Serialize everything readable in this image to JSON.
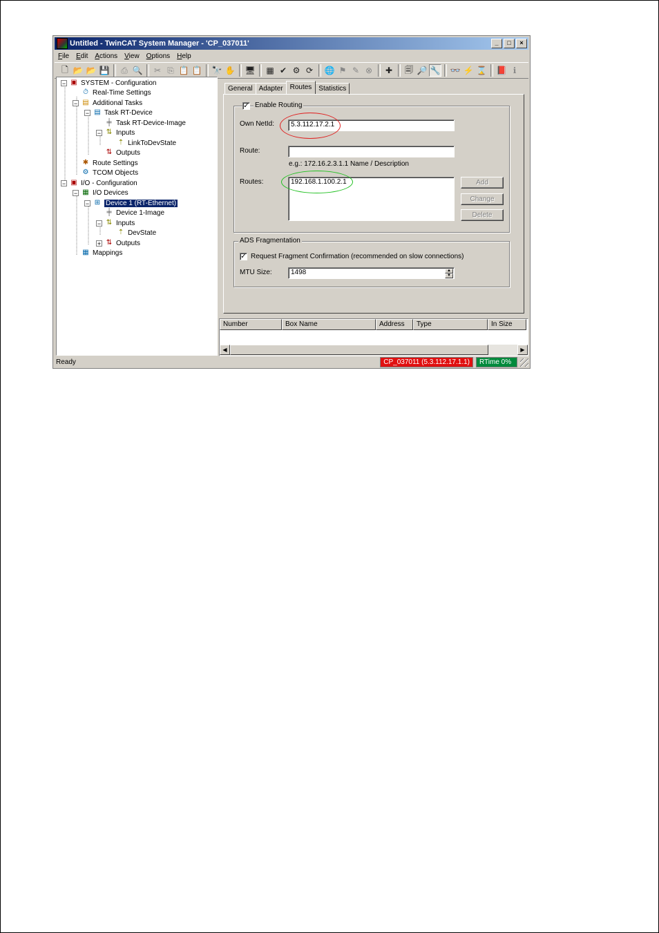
{
  "window": {
    "title": "Untitled - TwinCAT System Manager - 'CP_037011'",
    "buttons": [
      "_",
      "□",
      "×"
    ]
  },
  "menu": [
    {
      "key": "F",
      "rest": "ile"
    },
    {
      "key": "E",
      "rest": "dit"
    },
    {
      "key": "A",
      "rest": "ctions"
    },
    {
      "key": "V",
      "rest": "iew"
    },
    {
      "key": "O",
      "rest": "ptions"
    },
    {
      "key": "H",
      "rest": "elp"
    }
  ],
  "tree": {
    "items": [
      {
        "label": "SYSTEM - Configuration",
        "icon": "system-icon",
        "exp": "−"
      },
      {
        "label": "Real-Time Settings",
        "icon": "realtime-icon"
      },
      {
        "label": "Additional Tasks",
        "icon": "tasks-icon",
        "exp": "−"
      },
      {
        "label": "Task RT-Device",
        "icon": "task-icon",
        "exp": "−"
      },
      {
        "label": "Task RT-Device-Image",
        "icon": "image-icon"
      },
      {
        "label": "Inputs",
        "icon": "inputs-icon",
        "exp": "−"
      },
      {
        "label": "LinkToDevState",
        "icon": "variable-icon"
      },
      {
        "label": "Outputs",
        "icon": "outputs-icon"
      },
      {
        "label": "Route Settings",
        "icon": "route-icon"
      },
      {
        "label": "TCOM Objects",
        "icon": "tcom-icon"
      },
      {
        "label": "I/O - Configuration",
        "icon": "io-config-icon",
        "exp": "−"
      },
      {
        "label": "I/O Devices",
        "icon": "io-devices-icon",
        "exp": "−"
      },
      {
        "label": "Device 1 (RT-Ethernet)",
        "icon": "ethernet-device-icon",
        "exp": "−",
        "selected": true
      },
      {
        "label": "Device 1-Image",
        "icon": "image-icon"
      },
      {
        "label": "Inputs",
        "icon": "inputs-icon",
        "exp": "−"
      },
      {
        "label": "DevState",
        "icon": "variable-icon"
      },
      {
        "label": "Outputs",
        "icon": "outputs-icon",
        "exp": "+"
      },
      {
        "label": "Mappings",
        "icon": "mappings-icon"
      }
    ]
  },
  "tabs": [
    "General",
    "Adapter",
    "Routes",
    "Statistics"
  ],
  "active_tab": "Routes",
  "routing": {
    "enable_label": "Enable Routing",
    "enable_checked": true,
    "own_netid_label": "Own NetId:",
    "own_netid_value": "5.3.112.17.2.1",
    "route_label": "Route:",
    "route_value": "",
    "route_hint": "e.g.: 172.16.2.3.1.1  Name / Description",
    "routes_label": "Routes:",
    "routes_list": [
      "192.168.1.100.2.1"
    ],
    "buttons": {
      "add": "Add",
      "change": "Change",
      "delete": "Delete"
    },
    "highlight_colors": {
      "own_netid": "#e02020",
      "routes": "#20c020"
    }
  },
  "ads_fragmentation": {
    "title": "ADS Fragmentation",
    "request_label": "Request Fragment Confirmation (recommended on slow connections)",
    "request_checked": true,
    "mtu_label": "MTU Size:",
    "mtu_value": "1498"
  },
  "list_columns": [
    "Number",
    "Box Name",
    "Address",
    "Type",
    "In Size"
  ],
  "statusbar": {
    "text": "Ready",
    "target": "CP_037011 (5.3.112.17.1.1)",
    "rtime": "RTime 0%",
    "target_color": "#e01010",
    "rtime_color": "#008a3c"
  }
}
